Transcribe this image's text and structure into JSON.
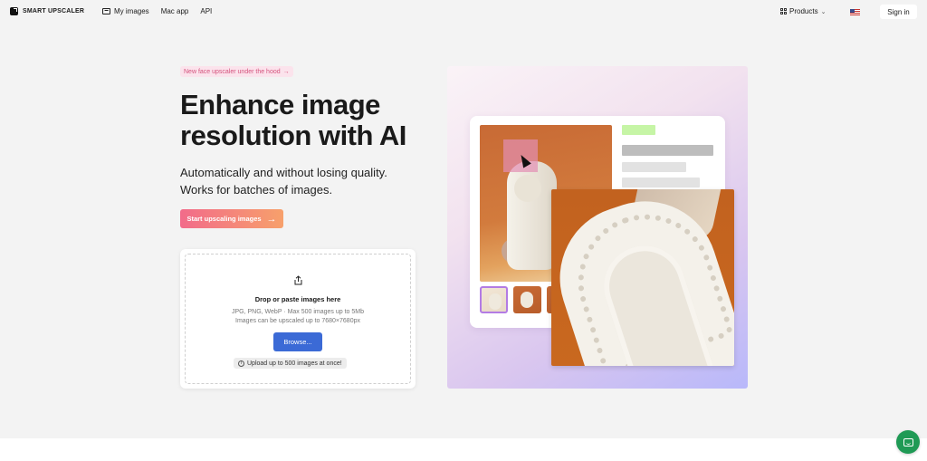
{
  "header": {
    "logo_text": "SMART UPSCALER",
    "nav": [
      {
        "label": "My images",
        "icon": "image-icon"
      },
      {
        "label": "Mac app"
      },
      {
        "label": "API"
      }
    ],
    "products_label": "Products",
    "flag": "us-flag-icon",
    "signin_label": "Sign in"
  },
  "hero": {
    "pill_text": "New face upscaler under the hood",
    "title": "Enhance image resolution with AI",
    "subtitle_line1": "Automatically and without losing quality.",
    "subtitle_line2": "Works for batches of images.",
    "cta_label": "Start upscaling images"
  },
  "upload": {
    "title": "Drop or paste images here",
    "meta_line1": "JPG, PNG, WebP · Max 500 images up to 5Mb",
    "meta_line2": "Images can be upscaled up to 7680×7680px",
    "browse_label": "Browse...",
    "tip": "Upload up to 500 images at once!"
  },
  "colors": {
    "accent_blue": "#3b6ad6",
    "cta_start": "#f26b8a",
    "cta_end": "#f7a06b",
    "chat_green": "#1f9a55"
  }
}
